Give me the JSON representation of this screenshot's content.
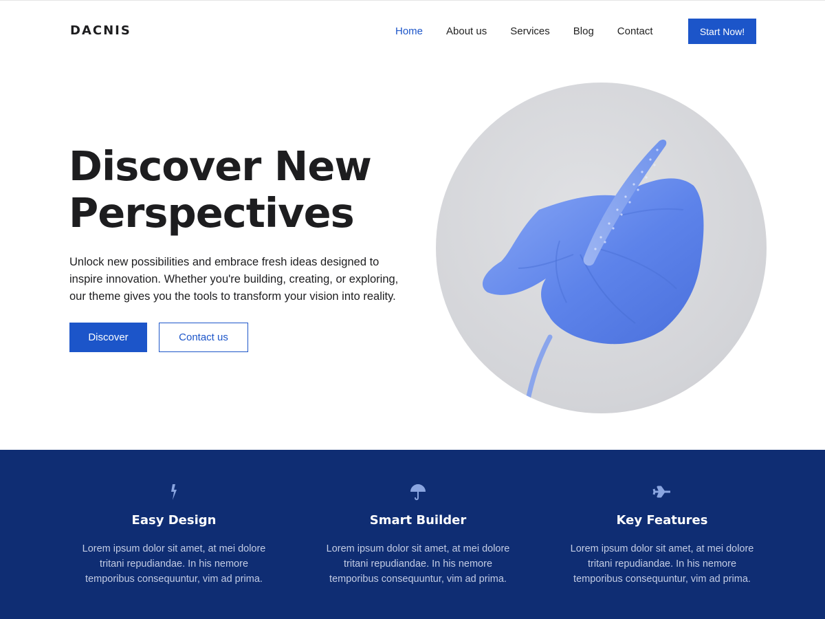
{
  "header": {
    "logo": "DACNIS",
    "nav": [
      {
        "label": "Home",
        "active": true
      },
      {
        "label": "About us",
        "active": false
      },
      {
        "label": "Services",
        "active": false
      },
      {
        "label": "Blog",
        "active": false
      },
      {
        "label": "Contact",
        "active": false
      }
    ],
    "cta_label": "Start Now!"
  },
  "hero": {
    "title_line1": "Discover New",
    "title_line2": "Perspectives",
    "text": "Unlock new possibilities and embrace fresh ideas designed to inspire innovation. Whether you're building, creating, or exploring, our theme gives you the tools to transform your vision into reality.",
    "primary_button": "Discover",
    "secondary_button": "Contact us",
    "image": "blue-anthurium-flower"
  },
  "features": [
    {
      "icon": "lightning-icon",
      "title": "Easy Design",
      "text": "Lorem ipsum dolor sit amet, at mei dolore tritani repudiandae. In his nemore temporibus consequuntur, vim ad prima."
    },
    {
      "icon": "umbrella-icon",
      "title": "Smart Builder",
      "text": "Lorem ipsum dolor sit amet, at mei dolore tritani repudiandae. In his nemore temporibus consequuntur, vim ad prima."
    },
    {
      "icon": "plane-icon",
      "title": "Key Features",
      "text": "Lorem ipsum dolor sit amet, at mei dolore tritani repudiandae. In his nemore temporibus consequuntur, vim ad prima."
    }
  ],
  "colors": {
    "accent": "#1c55c9",
    "features_bg": "#0f2d73",
    "icon": "#8aa5e0"
  }
}
